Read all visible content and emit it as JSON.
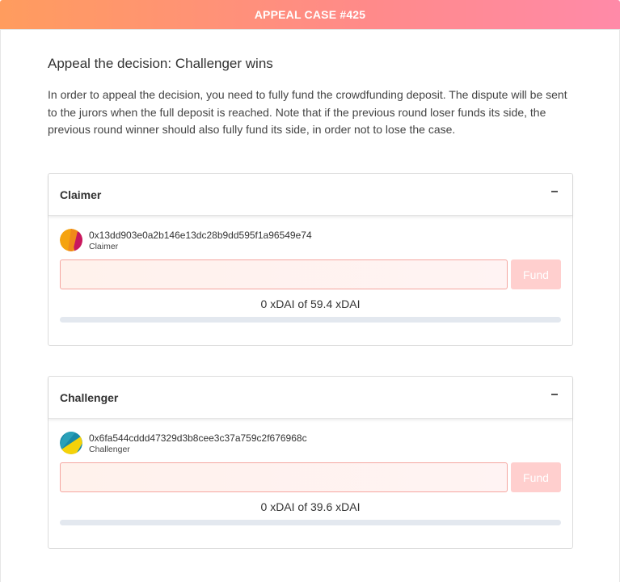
{
  "header": {
    "title": "APPEAL CASE #425"
  },
  "main": {
    "title": "Appeal the decision: Challenger wins",
    "description": "In order to appeal the decision, you need to fully fund the crowdfunding deposit. The dispute will be sent to the jurors when the full deposit is reached. Note that if the previous round loser funds its side, the previous round winner should also fully fund its side, in order not to lose the case."
  },
  "cards": [
    {
      "heading": "Claimer",
      "address": "0x13dd903e0a2b146e13dc28b9dd595f1a96549e74",
      "role": "Claimer",
      "input_value": "",
      "input_placeholder": "",
      "fund_label": "Fund",
      "progress_text": "0 xDAI of 59.4 xDAI",
      "funded_fraction": 0
    },
    {
      "heading": "Challenger",
      "address": "0x6fa544cddd47329d3b8cee3c37a759c2f676968c",
      "role": "Challenger",
      "input_value": "",
      "input_placeholder": "",
      "fund_label": "Fund",
      "progress_text": "0 xDAI of 39.6 xDAI",
      "funded_fraction": 0
    }
  ],
  "colors": {
    "accent": "#ff9c5e",
    "fund_button": "#ffcfce",
    "progress_track": "#e3e8ef"
  },
  "icons": {
    "collapse": "minus-icon",
    "avatar": "identicon"
  }
}
